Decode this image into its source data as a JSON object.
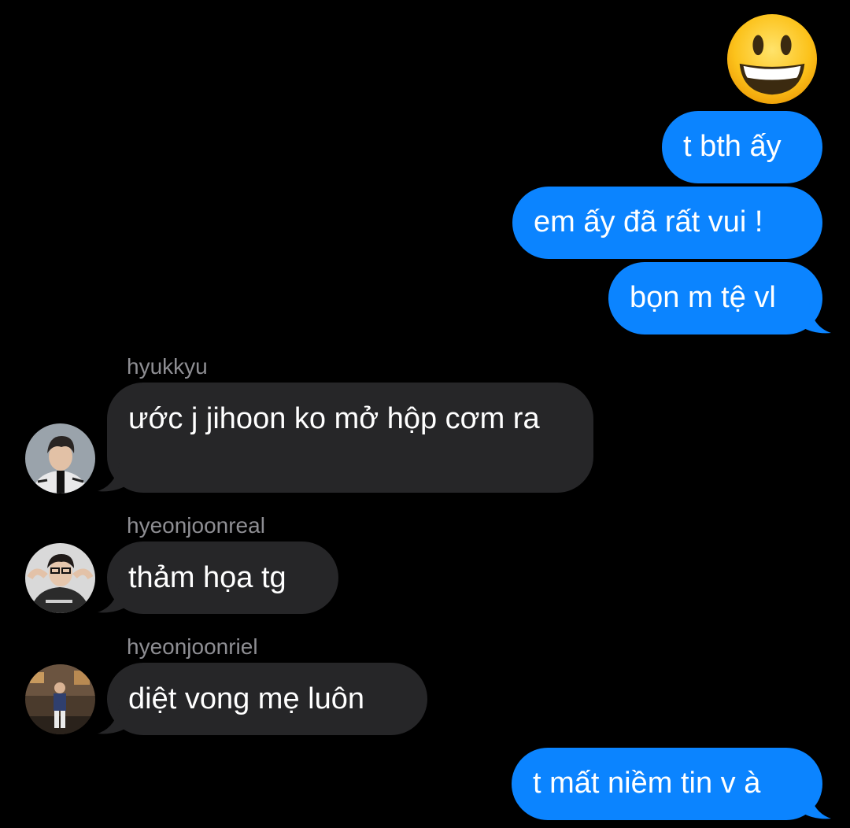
{
  "conversation": {
    "outgoing_top": [
      {
        "text": "t bth ấy"
      },
      {
        "text": "em ấy đã rất vui !"
      },
      {
        "text": "bọn m tệ vl"
      }
    ],
    "incoming": [
      {
        "sender": "hyukkyu",
        "text": "ước j jihoon ko mở hộp cơm ra"
      },
      {
        "sender": "hyeonjoonreal",
        "text": "thảm họa tg"
      },
      {
        "sender": "hyeonjoonriel",
        "text": "diệt vong mẹ luôn"
      }
    ],
    "outgoing_bottom": [
      {
        "text": "t mất niềm tin v à"
      }
    ]
  },
  "colors": {
    "background": "#000000",
    "outgoing_bubble": "#0b84ff",
    "incoming_bubble": "#262628",
    "sender_name": "#8e8e93",
    "text": "#ffffff"
  },
  "icons": {
    "reaction": "grinning-face-emoji",
    "avatars": [
      "hyukkyu-avatar",
      "hyeonjoonreal-avatar",
      "hyeonjoonriel-avatar"
    ]
  }
}
